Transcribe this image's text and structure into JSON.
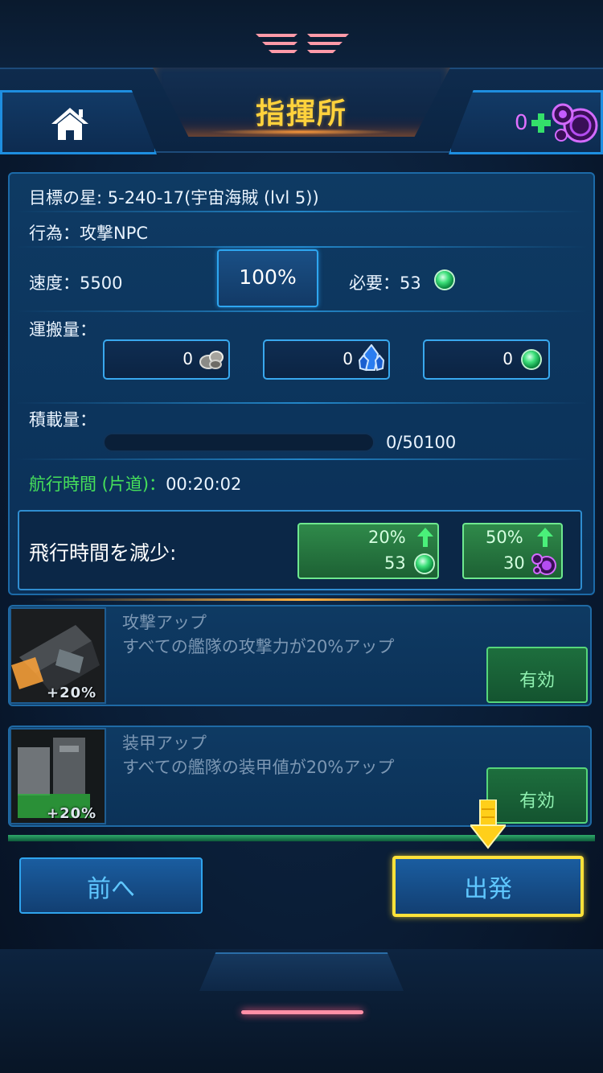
{
  "header": {
    "title": "指揮所",
    "home_icon": "home-icon",
    "premium_count": "0",
    "premium_icon": "purple-bubbles-icon",
    "add_icon": "plus-icon"
  },
  "mission": {
    "target": "目標の星: 5-240-17(宇宙海賊 (lvl 5))",
    "action": "行為：攻撃NPC",
    "speed_label": "速度：5500",
    "speed_percent": "100%",
    "required_label": "必要：53",
    "cargo_label": "運搬量：",
    "cargo": [
      {
        "value": "0",
        "icon": "ore-icon"
      },
      {
        "value": "0",
        "icon": "crystal-icon"
      },
      {
        "value": "0",
        "icon": "green-orb-icon"
      }
    ],
    "capacity_label": "積載量：",
    "capacity_value": "0/50100",
    "capacity_fill": 0,
    "flight_time_label": "航行時間 (片道)：",
    "flight_time_value": "00:20:02",
    "reduce_label": "飛行時間を減少:",
    "boosts": [
      {
        "percent": "20%",
        "cost": "53",
        "icon": "green-orb-icon"
      },
      {
        "percent": "50%",
        "cost": "30",
        "icon": "purple-bubbles-icon"
      }
    ]
  },
  "buffs": [
    {
      "title": "攻撃アップ",
      "desc": "すべての艦隊の攻撃力が20%アップ",
      "badge": "+20%",
      "button": "有効"
    },
    {
      "title": "装甲アップ",
      "desc": "すべての艦隊の装甲値が20%アップ",
      "badge": "+20%",
      "button": "有効"
    }
  ],
  "footer": {
    "back_label": "前へ",
    "depart_label": "出発"
  },
  "colors": {
    "title": "#ffd23c",
    "flight_time": "#46e05a",
    "highlight": "#ffe23a",
    "accent": "#2fa4ee"
  }
}
